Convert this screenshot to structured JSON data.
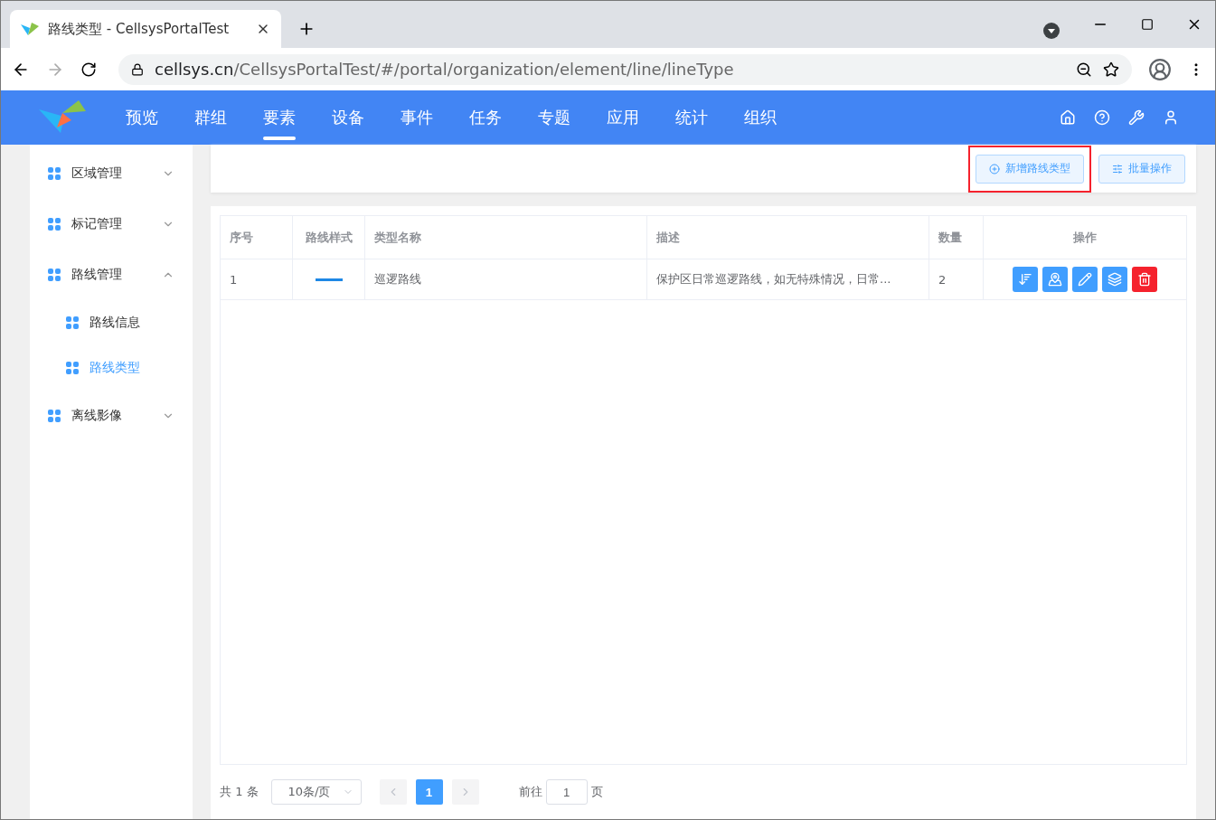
{
  "browser": {
    "tab_title": "路线类型 - CellsysPortalTest",
    "url_host": "cellsys.cn",
    "url_path": "/CellsysPortalTest/#/portal/organization/element/line/lineType"
  },
  "nav": {
    "items": [
      {
        "label": "预览",
        "selected": false
      },
      {
        "label": "群组",
        "selected": false
      },
      {
        "label": "要素",
        "selected": true
      },
      {
        "label": "设备",
        "selected": false
      },
      {
        "label": "事件",
        "selected": false
      },
      {
        "label": "任务",
        "selected": false
      },
      {
        "label": "专题",
        "selected": false
      },
      {
        "label": "应用",
        "selected": false
      },
      {
        "label": "统计",
        "selected": false
      },
      {
        "label": "组织",
        "selected": false
      }
    ]
  },
  "sidebar": {
    "items": [
      {
        "label": "区域管理",
        "expanded": false,
        "selected": false
      },
      {
        "label": "标记管理",
        "expanded": false,
        "selected": false
      },
      {
        "label": "路线管理",
        "expanded": true,
        "selected": false,
        "children": [
          {
            "label": "路线信息",
            "selected": false
          },
          {
            "label": "路线类型",
            "selected": true
          }
        ]
      },
      {
        "label": "离线影像",
        "expanded": false,
        "selected": false
      }
    ]
  },
  "toolbar": {
    "buttons": [
      {
        "label": "新增路线类型",
        "kind": "add",
        "highlighted": true
      },
      {
        "label": "批量操作",
        "kind": "batch",
        "highlighted": false
      }
    ]
  },
  "table": {
    "columns": [
      "序号",
      "路线样式",
      "类型名称",
      "描述",
      "数量",
      "操作"
    ],
    "rows": [
      {
        "index": "1",
        "name": "巡逻路线",
        "description": "保护区日常巡逻路线，如无特殊情况，日常...",
        "count": "2",
        "actions": [
          {
            "kind": "sort"
          },
          {
            "kind": "map"
          },
          {
            "kind": "edit"
          },
          {
            "kind": "layers"
          },
          {
            "kind": "delete"
          }
        ]
      }
    ]
  },
  "pagination": {
    "total": "共 1 条",
    "page_size": "10条/页",
    "pages": [
      {
        "label": "1",
        "selected": true
      }
    ],
    "goto_label": "前往",
    "goto_value": "1",
    "page_suffix": "页"
  }
}
